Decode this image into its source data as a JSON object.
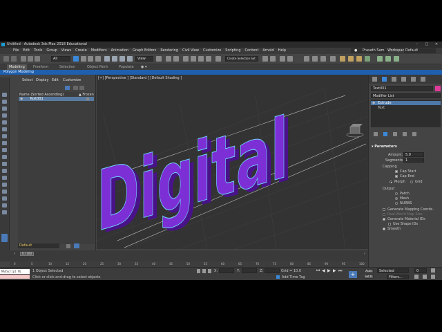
{
  "window": {
    "title": "Untitled - Autodesk 3ds Max 2018 Educational",
    "controls": [
      "–",
      "□",
      "✕"
    ]
  },
  "menu": [
    "File",
    "Edit",
    "Tools",
    "Group",
    "Views",
    "Create",
    "Modifiers",
    "Animation",
    "Graph Editors",
    "Rendering",
    "Civil View",
    "Customize",
    "Scripting",
    "Content",
    "Arnold",
    "Help"
  ],
  "user": {
    "name": "Prasath Sam",
    "workspaces_label": "Workspaces:",
    "workspace": "Default"
  },
  "toolbar": {
    "filter": "All",
    "view": "View",
    "selection_set": "Create Selection Set"
  },
  "ribbon": {
    "tabs": [
      "Modeling",
      "Freeform",
      "Selection",
      "Object Paint",
      "Populate"
    ],
    "sub_tab": "Polygon Modeling"
  },
  "scene_explorer": {
    "tabs": [
      "Select",
      "Display",
      "Edit",
      "Customize"
    ],
    "header": "Name (Sorted Ascending)",
    "frozen": "▲ Frozen",
    "items": [
      "Text001"
    ],
    "layer": "Default"
  },
  "viewport": {
    "label": "[+] [Perspective ] [Standard ] [Default Shading ]",
    "text": "Digital",
    "colors": {
      "fill": "#7d2fd6",
      "dark": "#4a128a",
      "outline": "#6fd6ff",
      "grid": "#3f3f3f"
    }
  },
  "command_panel": {
    "object_name": "Text001",
    "modifier_list": "Modifier List",
    "stack": [
      "Extrude",
      "Text"
    ],
    "rollout": "Parameters",
    "amount_label": "Amount:",
    "amount": "5.0",
    "segments_label": "Segments:",
    "segments": "1",
    "capping": "Capping",
    "cap_start": "Cap Start",
    "cap_end": "Cap End",
    "morph": "Morph",
    "grid": "Grid",
    "output": "Output",
    "patch": "Patch",
    "mesh": "Mesh",
    "nurbs": "NURBS",
    "gen_mapping": "Generate Mapping Coords.",
    "real_world": "Real-World Map Size",
    "gen_material": "Generate Material IDs",
    "use_shape": "Use Shape IDs",
    "smooth": "Smooth"
  },
  "timeline": {
    "frame": "0 / 100",
    "ticks": [
      "0",
      "5",
      "10",
      "15",
      "20",
      "25",
      "30",
      "35",
      "40",
      "45",
      "50",
      "55",
      "60",
      "65",
      "70",
      "75",
      "80",
      "85",
      "90",
      "95",
      "100"
    ]
  },
  "status": {
    "script": "MAXScript Mi",
    "selected": "1 Object Selected",
    "hint": "Click or click-and-drag to select objects",
    "x_label": "X:",
    "y_label": "Y:",
    "z_label": "Z:",
    "grid": "Grid = 10.0",
    "add_time_tag": "Add Time Tag",
    "auto": "Auto",
    "set_k": "Set K.",
    "selected_dd": "Selected",
    "filters": "Filters...",
    "frame_value": "0"
  }
}
